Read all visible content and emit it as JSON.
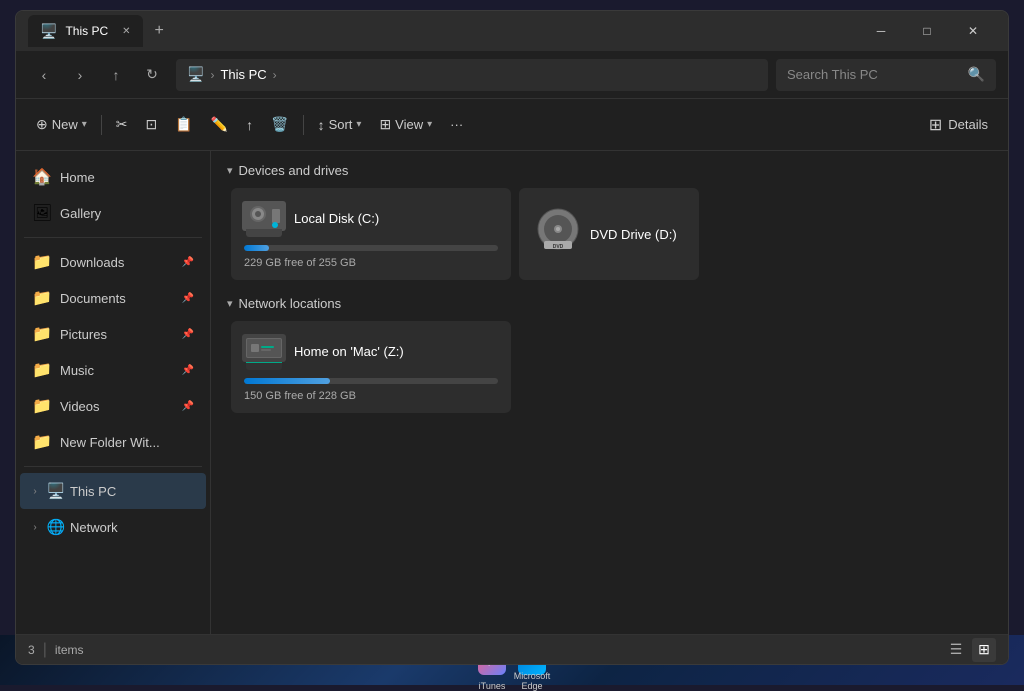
{
  "taskbar": {
    "items": [
      {
        "name": "iTunes",
        "label": "iTunes"
      },
      {
        "name": "Microsoft Edge",
        "label": "Microsoft\nEdge"
      }
    ]
  },
  "window": {
    "title": "This PC",
    "tab": {
      "icon": "🖥️",
      "label": "This PC"
    }
  },
  "navbar": {
    "back_tooltip": "Back",
    "forward_tooltip": "Forward",
    "up_tooltip": "Up",
    "refresh_tooltip": "Refresh",
    "address": {
      "icon": "🖥️",
      "path": "This PC"
    },
    "search_placeholder": "Search This PC"
  },
  "toolbar": {
    "new_label": "New",
    "cut_icon": "✂",
    "copy_icon": "⊡",
    "paste_icon": "📋",
    "rename_icon": "✏",
    "share_icon": "↑",
    "delete_icon": "🗑",
    "sort_label": "Sort",
    "view_label": "View",
    "more_icon": "···",
    "details_label": "Details"
  },
  "sidebar": {
    "items": [
      {
        "id": "home",
        "icon": "🏠",
        "label": "Home",
        "pinned": false
      },
      {
        "id": "gallery",
        "icon": "🖼",
        "label": "Gallery",
        "pinned": false
      }
    ],
    "pinned": [
      {
        "id": "downloads",
        "icon": "📁",
        "label": "Downloads",
        "pinned": true,
        "color": "#3a8bc8"
      },
      {
        "id": "documents",
        "icon": "📁",
        "label": "Documents",
        "pinned": true,
        "color": "#3a8bc8"
      },
      {
        "id": "pictures",
        "icon": "📁",
        "label": "Pictures",
        "pinned": true,
        "color": "#3a8bc8"
      },
      {
        "id": "music",
        "icon": "📁",
        "label": "Music",
        "pinned": true,
        "color": "#3a8bc8"
      },
      {
        "id": "videos",
        "icon": "📁",
        "label": "Videos",
        "pinned": true,
        "color": "#3a8bc8"
      },
      {
        "id": "new-folder",
        "icon": "📁",
        "label": "New Folder Wit...",
        "pinned": false,
        "color": "#e8c44a"
      }
    ],
    "tree": [
      {
        "id": "this-pc",
        "icon": "🖥️",
        "label": "This PC",
        "expanded": false,
        "active": true
      },
      {
        "id": "network",
        "icon": "🌐",
        "label": "Network",
        "expanded": false,
        "active": false
      }
    ]
  },
  "main": {
    "sections": [
      {
        "id": "devices-drives",
        "title": "Devices and drives",
        "expanded": true,
        "items": [
          {
            "id": "local-disk-c",
            "type": "hdd",
            "name": "Local Disk (C:)",
            "free": "229 GB free of 255 GB",
            "total_gb": 255,
            "free_gb": 229,
            "used_pct": 10,
            "progress_color": "#0078d4"
          },
          {
            "id": "dvd-drive-d",
            "type": "dvd",
            "name": "DVD Drive (D:)",
            "free": "",
            "total_gb": 0,
            "free_gb": 0,
            "used_pct": 0
          }
        ]
      },
      {
        "id": "network-locations",
        "title": "Network locations",
        "expanded": true,
        "items": [
          {
            "id": "mac-z",
            "type": "network-drive",
            "name": "Home on 'Mac' (Z:)",
            "free": "150 GB free of 228 GB",
            "total_gb": 228,
            "free_gb": 150,
            "used_pct": 34,
            "progress_color": "#0078d4"
          }
        ]
      }
    ]
  },
  "statusbar": {
    "count": "3",
    "count_label": "items"
  }
}
